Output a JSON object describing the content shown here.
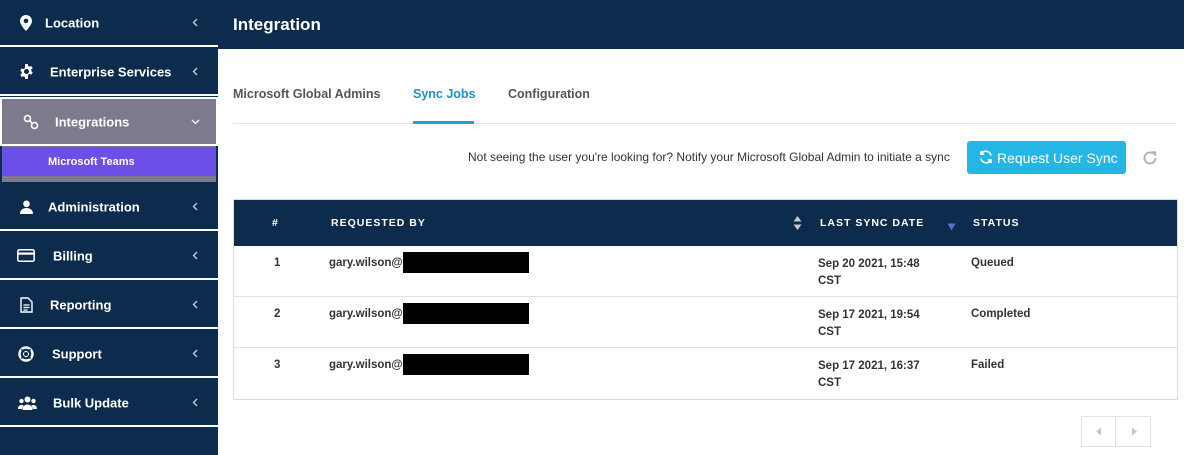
{
  "sidebar": {
    "items": [
      {
        "label": "Location",
        "icon": "map-pin-icon"
      },
      {
        "label": "Enterprise Services",
        "icon": "gear-icon"
      },
      {
        "label": "Integrations",
        "icon": "link-icon",
        "active": true
      },
      {
        "label": "Administration",
        "icon": "user-icon"
      },
      {
        "label": "Billing",
        "icon": "credit-card-icon"
      },
      {
        "label": "Reporting",
        "icon": "document-icon"
      },
      {
        "label": "Support",
        "icon": "lifebuoy-icon"
      },
      {
        "label": "Bulk Update",
        "icon": "users-icon"
      }
    ],
    "subitems": [
      {
        "label": "Microsoft Teams",
        "active": true
      }
    ]
  },
  "header": {
    "title": "Integration"
  },
  "tabs": [
    {
      "label": "Microsoft Global Admins"
    },
    {
      "label": "Sync Jobs",
      "active": true
    },
    {
      "label": "Configuration"
    }
  ],
  "notice": "Not seeing the user you're looking for? Notify your Microsoft Global Admin to initiate a sync",
  "sync_button": {
    "label": "Request User Sync"
  },
  "table": {
    "columns": [
      "#",
      "REQUESTED BY",
      "LAST SYNC DATE",
      "STATUS"
    ],
    "sorted_column": "LAST SYNC DATE",
    "sort_direction": "desc",
    "rows": [
      {
        "index": "1",
        "requested_by": "gary.wilson@",
        "date_line1": "Sep 20 2021, 15:48",
        "date_line2": "CST",
        "status": "Queued"
      },
      {
        "index": "2",
        "requested_by": "gary.wilson@",
        "date_line1": "Sep 17 2021, 19:54",
        "date_line2": "CST",
        "status": "Completed"
      },
      {
        "index": "3",
        "requested_by": "gary.wilson@",
        "date_line1": "Sep 17 2021, 16:37",
        "date_line2": "CST",
        "status": "Failed"
      }
    ]
  },
  "colors": {
    "navy": "#0d2b4d",
    "active_nav": "#7c7a8c",
    "subnav_active": "#6c4fe6",
    "accent": "#24b7e5",
    "tab_active": "#1f8fc7"
  }
}
